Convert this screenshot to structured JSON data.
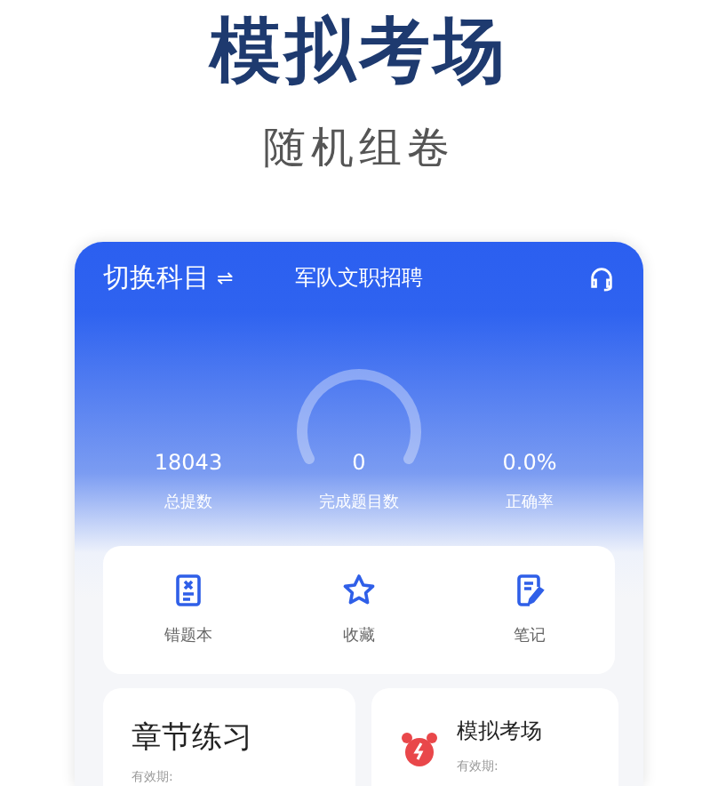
{
  "headline": "模拟考场",
  "subtitle": "随机组卷",
  "phone": {
    "switch_label": "切换科目",
    "switch_icon": "⇌",
    "title": "军队文职招聘",
    "stats": [
      {
        "value": "18043",
        "label": "总提数",
        "kind": "plain"
      },
      {
        "value": "0",
        "label": "完成题目数",
        "kind": "gauge"
      },
      {
        "value": "0.0%",
        "label": "正确率",
        "kind": "plain"
      }
    ],
    "tools": [
      {
        "label": "错题本",
        "kind": "wrongbook"
      },
      {
        "label": "收藏",
        "kind": "star"
      },
      {
        "label": "笔记",
        "kind": "note"
      }
    ],
    "cards": [
      {
        "title": "章节练习",
        "validity": "有效期:",
        "kind": "chapter"
      },
      {
        "title": "模拟考场",
        "validity": "有效期:",
        "kind": "exam"
      }
    ]
  }
}
